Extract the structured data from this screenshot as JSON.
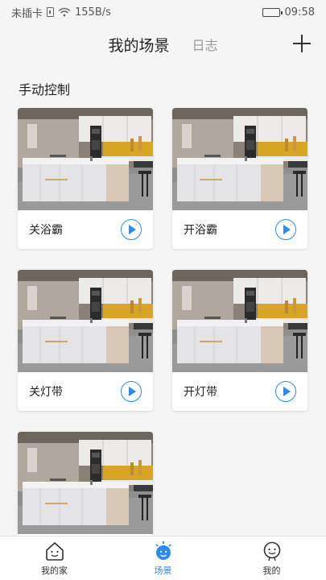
{
  "status_bar": {
    "carrier": "未插卡",
    "speed": "155B/s",
    "time": "09:58"
  },
  "header": {
    "tab_active": "我的场景",
    "tab_inactive": "日志",
    "add_icon": "plus-icon"
  },
  "section": {
    "title": "手动控制"
  },
  "scenes": [
    {
      "label": "关浴霸",
      "image": "kitchen-photo"
    },
    {
      "label": "开浴霸",
      "image": "kitchen-photo"
    },
    {
      "label": "关灯带",
      "image": "kitchen-photo"
    },
    {
      "label": "开灯带",
      "image": "kitchen-photo"
    },
    {
      "label": "",
      "image": "kitchen-photo"
    }
  ],
  "bottom_nav": {
    "items": [
      {
        "label": "我的家",
        "icon": "home-icon"
      },
      {
        "label": "场景",
        "icon": "scene-icon"
      },
      {
        "label": "我的",
        "icon": "profile-icon"
      }
    ],
    "active_index": 1
  },
  "colors": {
    "accent": "#2e8be8",
    "background": "#f5f5f5"
  }
}
